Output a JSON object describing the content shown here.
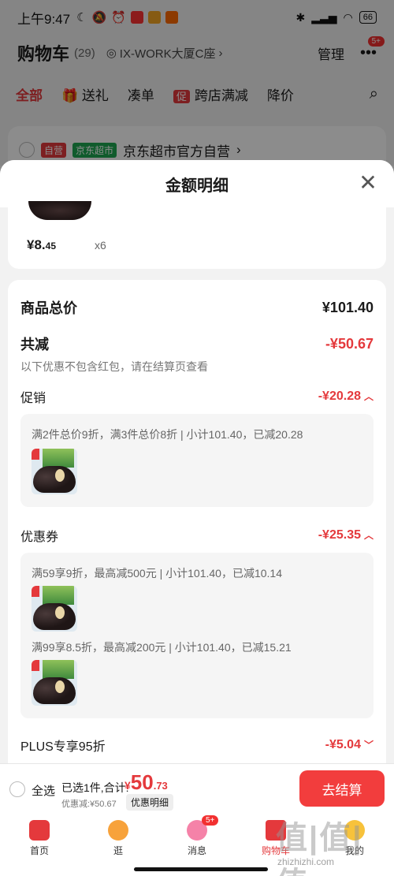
{
  "status": {
    "time": "上午9:47",
    "battery": "66"
  },
  "header": {
    "title": "购物车",
    "count": "(29)",
    "address": "IX-WORK大厦C座",
    "manage": "管理",
    "more_badge": "5+"
  },
  "filters": [
    {
      "label": "全部"
    },
    {
      "label": "送礼"
    },
    {
      "label": "凑单"
    },
    {
      "promo_tag": "促",
      "label": "跨店满减"
    },
    {
      "label": "降价"
    }
  ],
  "store": {
    "tag_self": "自营",
    "tag_jd": "京东超市",
    "name": "京东超市官方自营"
  },
  "sheet": {
    "title": "金额明细",
    "product": {
      "price_int": "¥8.",
      "price_dec": "45",
      "qty": "x6"
    },
    "total_label": "商品总价",
    "total_value": "¥101.40",
    "reduce_label": "共减",
    "reduce_value": "-¥50.67",
    "reduce_note": "以下优惠不包含红包，请在结算页查看",
    "promo_label": "促销",
    "promo_value": "-¥20.28",
    "promo_line": "满2件总价9折，满3件总价8折 | 小计101.40，已减20.28",
    "coupon_label": "优惠券",
    "coupon_value": "-¥25.35",
    "coupon_line1": "满59享9折，最高减500元 | 小计101.40，已减10.14",
    "coupon_line2": "满99享8.5折，最高减200元 | 小计101.40，已减15.21",
    "plus_label": "PLUS专享95折",
    "plus_value": "-¥5.04"
  },
  "checkout": {
    "select_all": "全选",
    "selected": "已选1件,合计:",
    "currency": "¥",
    "total_int": "50",
    "total_dec": ".73",
    "discount": "优惠减:¥50.67",
    "detail": "优惠明细",
    "button": "去结算"
  },
  "tabs": [
    {
      "label": "首页"
    },
    {
      "label": "逛"
    },
    {
      "label": "消息",
      "badge": "5+"
    },
    {
      "label": "购物车"
    },
    {
      "label": "我的"
    }
  ],
  "watermark": {
    "text": "值|值|值",
    "url": "zhizhizhi.com"
  },
  "colors": {
    "accent": "#e4393c",
    "jd_green": "#1ea650"
  }
}
